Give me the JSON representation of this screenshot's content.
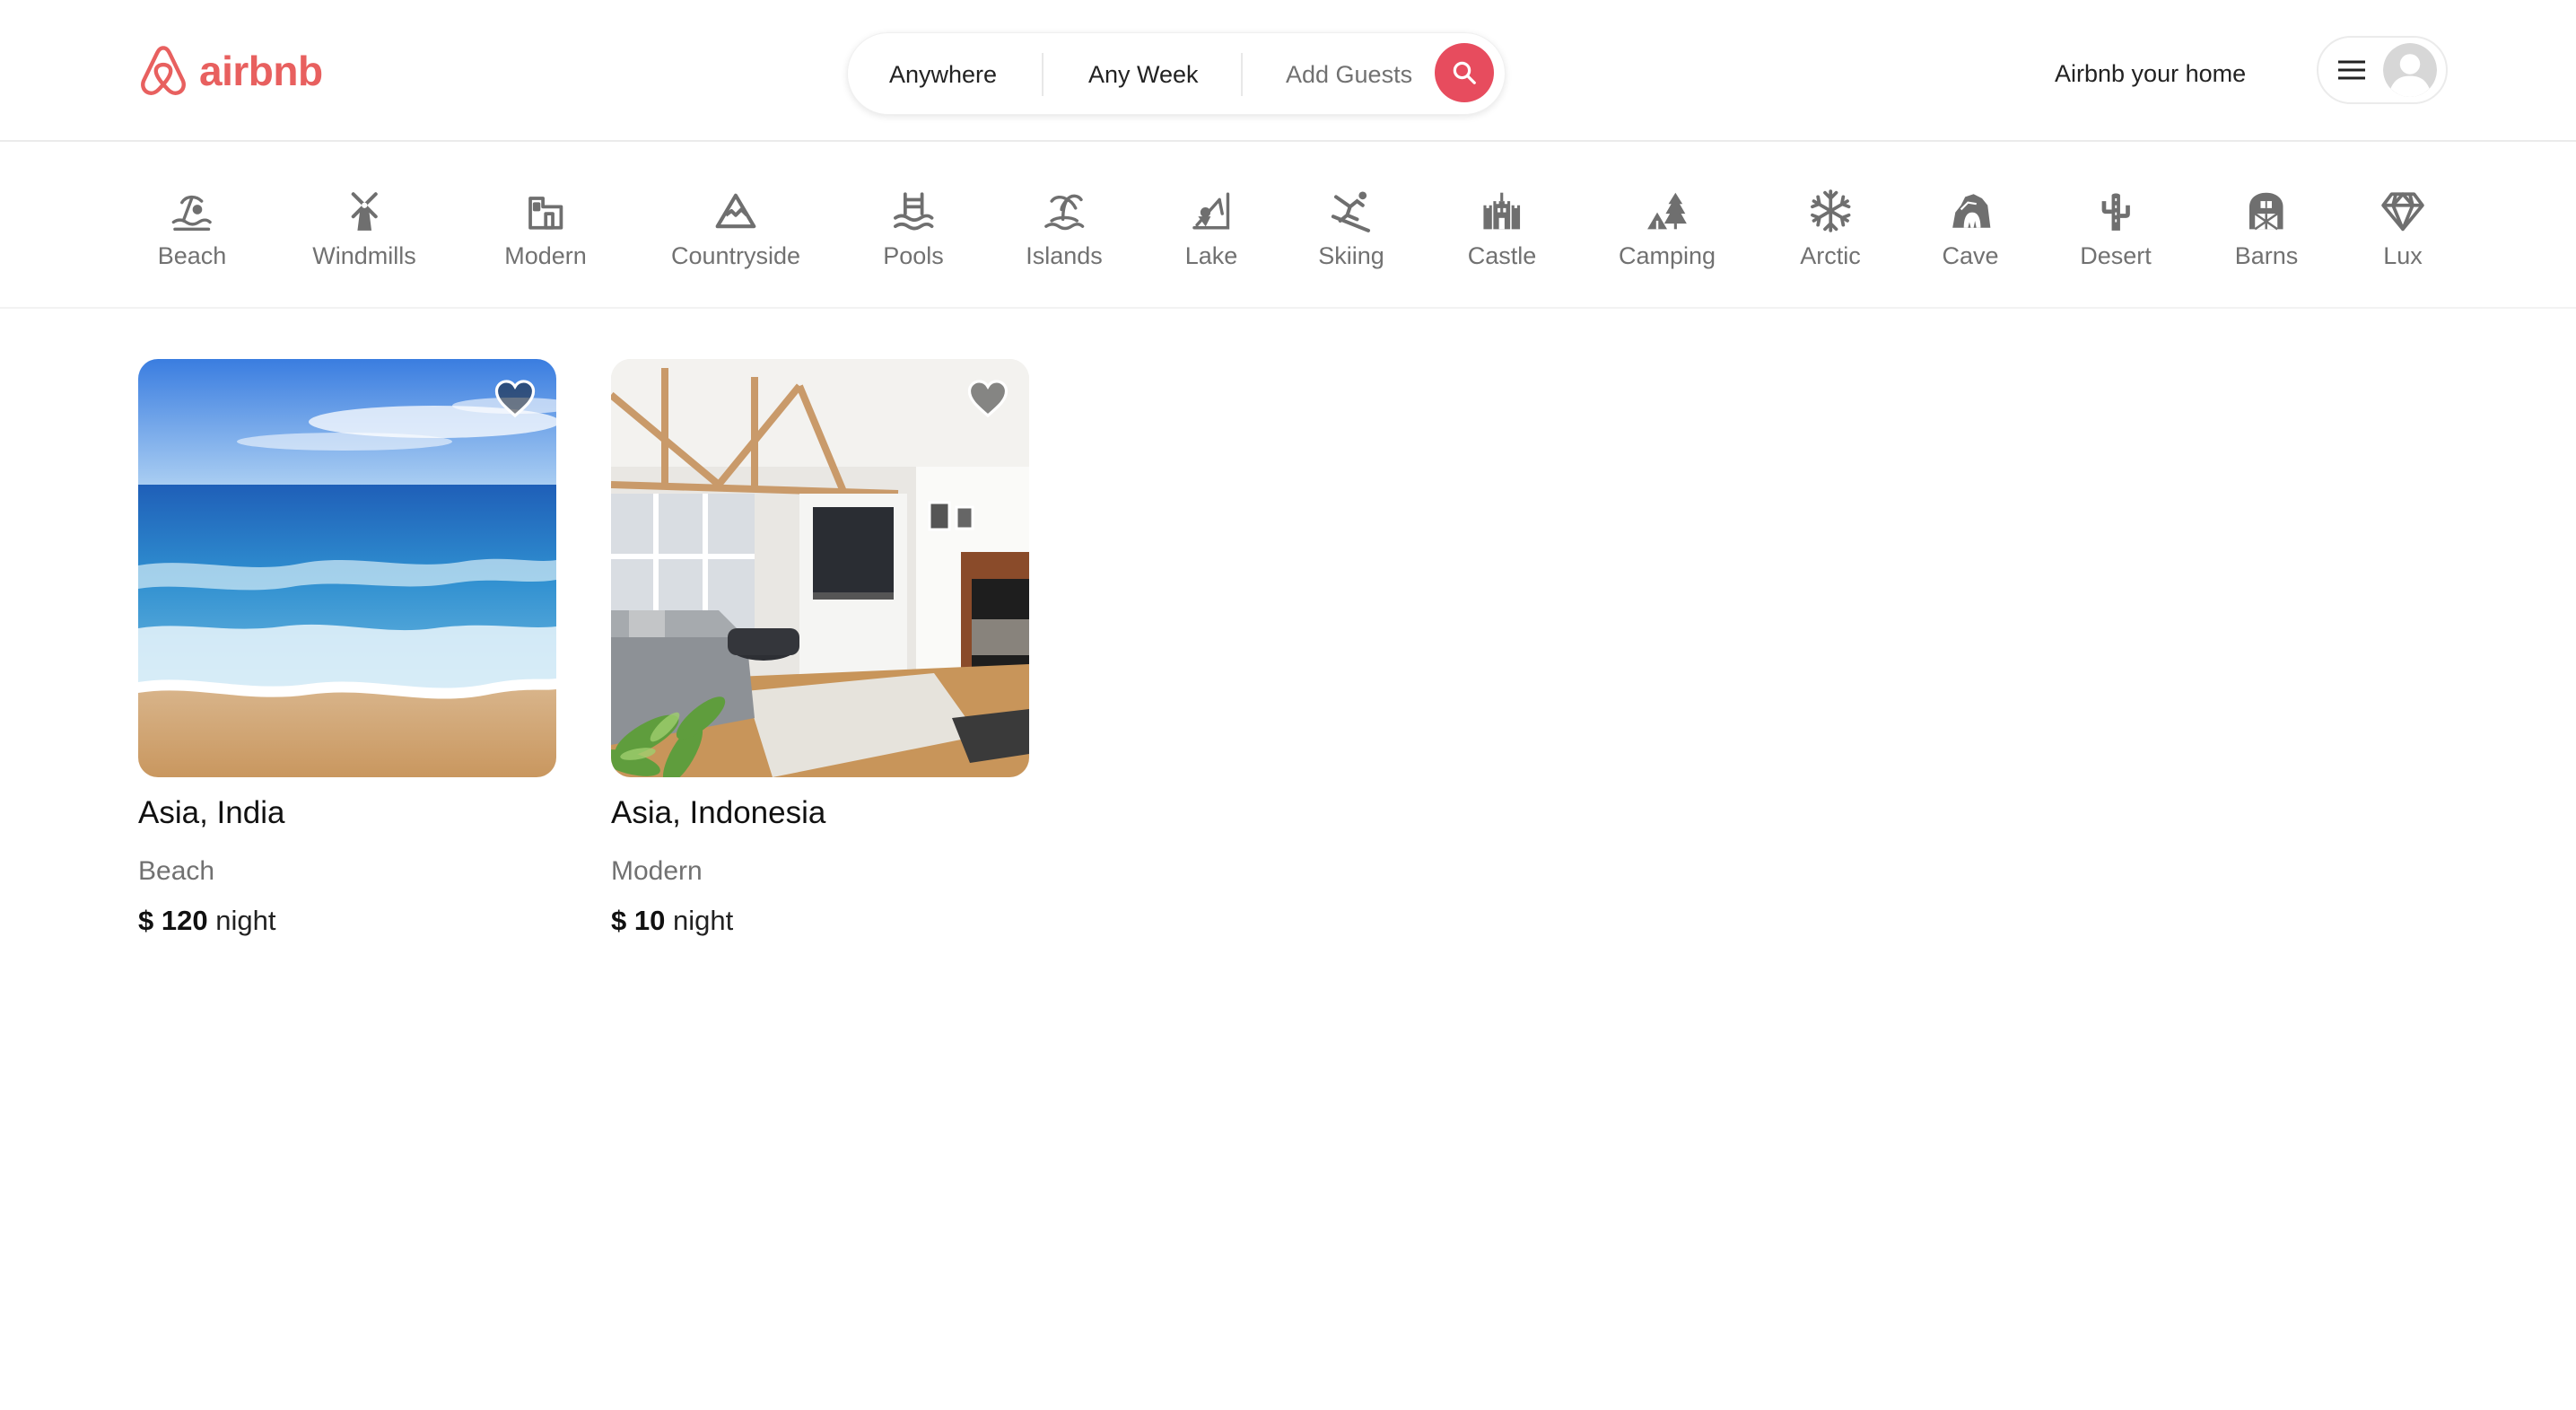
{
  "brand": {
    "name": "airbnb",
    "color": "#e8605f"
  },
  "search": {
    "where": "Anywhere",
    "when": "Any Week",
    "guests": "Add Guests",
    "button_color": "#e74c5e",
    "icon": "search-icon"
  },
  "user_menu": {
    "host_link": "Airbnb your home",
    "menu_icon": "hamburger-icon",
    "avatar_icon": "avatar-placeholder"
  },
  "categories": [
    {
      "label": "Beach",
      "icon": "beach-icon"
    },
    {
      "label": "Windmills",
      "icon": "windmill-icon"
    },
    {
      "label": "Modern",
      "icon": "modern-house-icon"
    },
    {
      "label": "Countryside",
      "icon": "mountain-icon"
    },
    {
      "label": "Pools",
      "icon": "pool-icon"
    },
    {
      "label": "Islands",
      "icon": "island-icon"
    },
    {
      "label": "Lake",
      "icon": "lake-icon"
    },
    {
      "label": "Skiing",
      "icon": "skiing-icon"
    },
    {
      "label": "Castle",
      "icon": "castle-icon"
    },
    {
      "label": "Camping",
      "icon": "camping-icon"
    },
    {
      "label": "Arctic",
      "icon": "snowflake-icon"
    },
    {
      "label": "Cave",
      "icon": "cave-icon"
    },
    {
      "label": "Desert",
      "icon": "cactus-icon"
    },
    {
      "label": "Barns",
      "icon": "barn-icon"
    },
    {
      "label": "Lux",
      "icon": "diamond-icon"
    }
  ],
  "listings": [
    {
      "location": "Asia, India",
      "category": "Beach",
      "price": "$ 120",
      "price_unit": "night",
      "photo": "beach-photo"
    },
    {
      "location": "Asia, Indonesia",
      "category": "Modern",
      "price": "$ 10",
      "price_unit": "night",
      "photo": "living-room-photo"
    }
  ]
}
